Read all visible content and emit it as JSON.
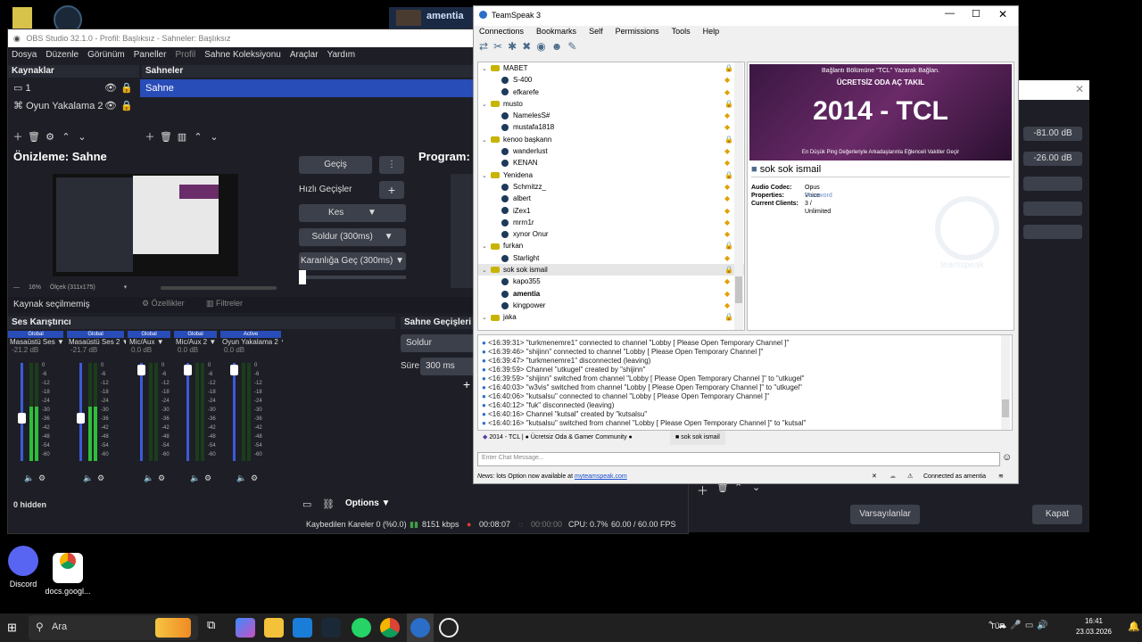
{
  "desktop": {
    "icons": [
      {
        "label": "Discord"
      },
      {
        "label": "docs.googl..."
      }
    ],
    "bg_window_title": "amentia"
  },
  "obs": {
    "title": "OBS Studio 32.1.0 - Profil: Başlıksız - Sahneler: Başlıksız",
    "menu": [
      "Dosya",
      "Düzenle",
      "Görünüm",
      "Paneller",
      "Profil",
      "Sahne Koleksiyonu",
      "Araçlar",
      "Yardım"
    ],
    "sources_header": "Kaynaklar",
    "sources": [
      {
        "label": "1"
      },
      {
        "label": "Oyun Yakalama 2"
      }
    ],
    "scenes_header": "Sahneler",
    "scenes": [
      {
        "label": "Sahne"
      }
    ],
    "preview_label": "Önizleme: Sahne",
    "program_label": "Program:",
    "transition_button": "Geçiş",
    "quick_transitions": "Hızlı Geçişler",
    "transitions": [
      "Kes",
      "Soldur (300ms)",
      "Karanlığa Geç (300ms)"
    ],
    "preview_zoom": "16%",
    "preview_scale": "Ölçek (311x175)",
    "no_source_selected": "Kaynak seçilmemiş",
    "properties_button": "Özellikler",
    "filters_button": "Filtreler",
    "mixer_header": "Ses Karıştırıcı",
    "mixer_channels": [
      {
        "tag": "Global",
        "name": "Masaüstü Ses",
        "db": "-21.2 dB",
        "level": 0.55
      },
      {
        "tag": "Global",
        "name": "Masaüstü Ses 2",
        "db": "-21.7 dB",
        "level": 0.55
      },
      {
        "tag": "Global",
        "name": "Mic/Aux",
        "db": "0.0 dB",
        "level": 0.0
      },
      {
        "tag": "Global",
        "name": "Mic/Aux 2",
        "db": "0.0 dB",
        "level": 0.0
      },
      {
        "tag": "Active",
        "name": "Oyun Yakalama 2",
        "db": "0.0 dB",
        "level": 0.0
      }
    ],
    "meter_ticks": [
      "0",
      "-6",
      "-12",
      "-18",
      "-24",
      "-30",
      "-36",
      "-42",
      "-48",
      "-54",
      "-60"
    ],
    "hidden_count": "0 hidden",
    "options_button": "Options",
    "scene_transitions_header": "Sahne Geçişleri",
    "scene_transition_value": "Soldur",
    "duration_label": "Süre",
    "duration_value": "300 ms",
    "status": {
      "dropped": "Kaybedilen Kareler 0 (%0.0)",
      "bitrate": "8151 kbps",
      "rec_time": "00:08:07",
      "stream_time": "00:00:00",
      "cpu": "CPU: 0.7%",
      "fps": "60.00 / 60.00 FPS"
    }
  },
  "settings_window": {
    "value1": "-81.00 dB",
    "value2": "-26.00 dB",
    "defaults_button": "Varsayılanlar",
    "close_button": "Kapat"
  },
  "teamspeak": {
    "title": "TeamSpeak 3",
    "menu": [
      "Connections",
      "Bookmarks",
      "Self",
      "Permissions",
      "Tools",
      "Help"
    ],
    "tree": [
      {
        "type": "channel",
        "label": "MABET"
      },
      {
        "type": "user",
        "label": "S-400"
      },
      {
        "type": "user",
        "label": "efkarefe"
      },
      {
        "type": "channel",
        "label": "musto"
      },
      {
        "type": "user",
        "label": "NamelesS#"
      },
      {
        "type": "user",
        "label": "mustafa1818"
      },
      {
        "type": "channel",
        "label": "kenoo başkann"
      },
      {
        "type": "user",
        "label": "wanderlust"
      },
      {
        "type": "user",
        "label": "KENAN"
      },
      {
        "type": "channel",
        "label": "Yenidena"
      },
      {
        "type": "user",
        "label": "Schmitzz_"
      },
      {
        "type": "user",
        "label": "albert"
      },
      {
        "type": "user",
        "label": "iZex1"
      },
      {
        "type": "user",
        "label": "mrrn1r"
      },
      {
        "type": "user",
        "label": "xynor Onur"
      },
      {
        "type": "channel",
        "label": "furkan"
      },
      {
        "type": "user",
        "label": "Starlight"
      },
      {
        "type": "channel",
        "label": "sok sok ismail",
        "selected": true
      },
      {
        "type": "user",
        "label": "kapo355"
      },
      {
        "type": "user",
        "label": "amentia",
        "bold": true
      },
      {
        "type": "user",
        "label": "kingpower"
      },
      {
        "type": "channel",
        "label": "jaka"
      }
    ],
    "banner_top": "Bağlantı Bölümüne \"TCL\" Yazarak Bağlan.",
    "banner_sub": "ÜCRETSİZ ODA AÇ TAKIL",
    "banner_main": "2014 - TCL",
    "banner_bottom": "En Düşük Ping Değerleriyle Arkadaşlarınla Eğlenceli Vakitler Geçir",
    "channel_name": "sok sok ismail",
    "info": [
      {
        "key": "Audio Codec:",
        "value": "Opus Voice"
      },
      {
        "key": "Properties:",
        "value": "Password"
      },
      {
        "key": "Current Clients:",
        "value": "3 / Unlimited"
      }
    ],
    "watermark": "teamspeak",
    "log": [
      {
        "time": "<16:39:31>",
        "text": "\"turkmenemre1\" connected to channel \"Lobby [ Please Open Temporary Channel ]\""
      },
      {
        "time": "<16:39:46>",
        "text": "\"shijinn\" connected to channel \"Lobby [ Please Open Temporary Channel ]\""
      },
      {
        "time": "<16:39:47>",
        "text": "\"turkmenemre1\" disconnected (leaving)"
      },
      {
        "time": "<16:39:59>",
        "text": "Channel \"utkugel\" created by \"shijinn\""
      },
      {
        "time": "<16:39:59>",
        "text": "\"shijinn\" switched from channel \"Lobby [ Please Open Temporary Channel ]\" to \"utkugel\""
      },
      {
        "time": "<16:40:03>",
        "text": "\"w3vis\" switched from channel \"Lobby [ Please Open Temporary Channel ]\" to \"utkugel\""
      },
      {
        "time": "<16:40:06>",
        "text": "\"kutsalsu\" connected to channel \"Lobby [ Please Open Temporary Channel ]\""
      },
      {
        "time": "<16:40:12>",
        "text": "\"fuk\" disconnected (leaving)"
      },
      {
        "time": "<16:40:16>",
        "text": "Channel \"kutsal\" created by \"kutsalsu\""
      },
      {
        "time": "<16:40:16>",
        "text": "\"kutsalsu\" switched from channel \"Lobby [ Please Open Temporary Channel ]\" to \"kutsal\""
      }
    ],
    "tabs": [
      {
        "label": "2014 - TCL | ● Ücretsiz Oda & Gamer Community ●"
      },
      {
        "label": "sok sok ismail"
      }
    ],
    "chat_placeholder": "Enter Chat Message...",
    "news_label": "News:",
    "news_text": "lots Option now available at",
    "news_link": "myteamspeak.com",
    "connected_as": "Connected as amentia"
  },
  "taskbar": {
    "search_placeholder": "Ara",
    "time": "16:41",
    "date": "23.03.2026",
    "lang": "TÜR"
  }
}
